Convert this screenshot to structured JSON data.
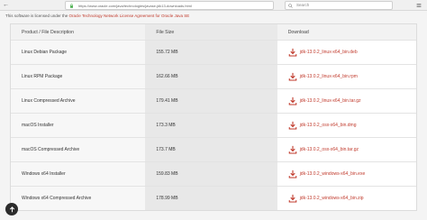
{
  "browser": {
    "url": "https://www.oracle.com/java/technologies/javase-jdk13-downloads.html",
    "search_placeholder": "Search"
  },
  "notice": {
    "prefix": "This software is licensed under the ",
    "link": "Oracle Technology Network License Agreement for Oracle Java SE"
  },
  "table": {
    "headers": [
      "Product / File Description",
      "File Size",
      "Download"
    ],
    "rows": [
      {
        "desc": "Linux Debian Package",
        "size": "155.72 MB",
        "file": "jdk-13.0.2_linux-x64_bin.deb"
      },
      {
        "desc": "Linux RPM Package",
        "size": "162.66 MB",
        "file": "jdk-13.0.2_linux-x64_bin.rpm"
      },
      {
        "desc": "Linux Compressed Archive",
        "size": "179.41 MB",
        "file": "jdk-13.0.2_linux-x64_bin.tar.gz"
      },
      {
        "desc": "macOS Installer",
        "size": "173.3 MB",
        "file": "jdk-13.0.2_osx-x64_bin.dmg"
      },
      {
        "desc": "macOS Compressed Archive",
        "size": "173.7 MB",
        "file": "jdk-13.0.2_osx-x64_bin.tar.gz"
      },
      {
        "desc": "Windows x64 Installer",
        "size": "159.83 MB",
        "file": "jdk-13.0.2_windows-x64_bin.exe"
      },
      {
        "desc": "Windows x64 Compressed Archive",
        "size": "178.99 MB",
        "file": "jdk-13.0.2_windows-x64_bin.zip"
      }
    ]
  },
  "colors": {
    "accent": "#c0392b"
  }
}
